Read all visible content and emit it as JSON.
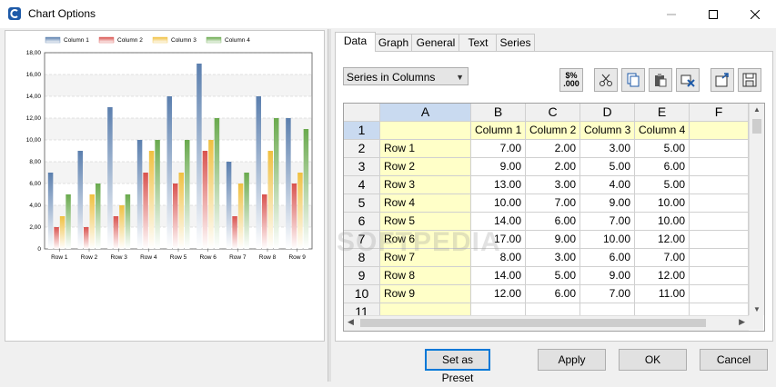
{
  "window": {
    "title": "Chart Options",
    "controls": [
      "minimize",
      "maximize",
      "close"
    ]
  },
  "tabs": [
    {
      "label": "Data",
      "active": true
    },
    {
      "label": "Graph",
      "active": false
    },
    {
      "label": "General",
      "active": false
    },
    {
      "label": "Text",
      "active": false
    },
    {
      "label": "Series",
      "active": false
    }
  ],
  "data_tab": {
    "series_select": "Series in Columns",
    "toolbar": [
      "number-format-icon",
      "cut-icon",
      "copy-icon",
      "paste-icon",
      "clear-icon",
      "export-icon",
      "save-icon"
    ],
    "number_format_label_top": "$%",
    "number_format_label_bottom": ".000",
    "column_headers": [
      "A",
      "B",
      "C",
      "D",
      "E",
      "F"
    ],
    "row_headers": [
      "1",
      "2",
      "3",
      "4",
      "5",
      "6",
      "7",
      "8",
      "9",
      "10",
      "11"
    ],
    "series_names": [
      "Column 1",
      "Column 2",
      "Column 3",
      "Column 4"
    ],
    "rows": [
      {
        "label": "Row 1",
        "values": [
          "7.00",
          "2.00",
          "3.00",
          "5.00"
        ]
      },
      {
        "label": "Row 2",
        "values": [
          "9.00",
          "2.00",
          "5.00",
          "6.00"
        ]
      },
      {
        "label": "Row 3",
        "values": [
          "13.00",
          "3.00",
          "4.00",
          "5.00"
        ]
      },
      {
        "label": "Row 4",
        "values": [
          "10.00",
          "7.00",
          "9.00",
          "10.00"
        ]
      },
      {
        "label": "Row 5",
        "values": [
          "14.00",
          "6.00",
          "7.00",
          "10.00"
        ]
      },
      {
        "label": "Row 6",
        "values": [
          "17.00",
          "9.00",
          "10.00",
          "12.00"
        ]
      },
      {
        "label": "Row 7",
        "values": [
          "8.00",
          "3.00",
          "6.00",
          "7.00"
        ]
      },
      {
        "label": "Row 8",
        "values": [
          "14.00",
          "5.00",
          "9.00",
          "12.00"
        ]
      },
      {
        "label": "Row 9",
        "values": [
          "12.00",
          "6.00",
          "7.00",
          "11.00"
        ]
      }
    ]
  },
  "buttons": {
    "preset": "Set as Preset",
    "apply": "Apply",
    "ok": "OK",
    "cancel": "Cancel"
  },
  "watermark": "SOFTPEDIA",
  "colors": {
    "series": [
      "#5b7fae",
      "#d9534f",
      "#f0c040",
      "#6aaa4e"
    ],
    "selected_header": "#c9daf0",
    "label_cell": "#ffffc8"
  },
  "chart_data": {
    "type": "bar",
    "categories": [
      "Row 1",
      "Row 2",
      "Row 3",
      "Row 4",
      "Row 5",
      "Row 6",
      "Row 7",
      "Row 8",
      "Row 9"
    ],
    "series": [
      {
        "name": "Column 1",
        "values": [
          7,
          9,
          13,
          10,
          14,
          17,
          8,
          14,
          12
        ]
      },
      {
        "name": "Column 2",
        "values": [
          2,
          2,
          3,
          7,
          6,
          9,
          3,
          5,
          6
        ]
      },
      {
        "name": "Column 3",
        "values": [
          3,
          5,
          4,
          9,
          7,
          10,
          6,
          9,
          7
        ]
      },
      {
        "name": "Column 4",
        "values": [
          5,
          6,
          5,
          10,
          10,
          12,
          7,
          12,
          11
        ]
      }
    ],
    "yticks": [
      "0",
      "2,00",
      "4,00",
      "6,00",
      "8,00",
      "10,00",
      "12,00",
      "14,00",
      "16,00",
      "18,00"
    ],
    "ylim": [
      0,
      18
    ],
    "grid": true,
    "legend": "top"
  }
}
